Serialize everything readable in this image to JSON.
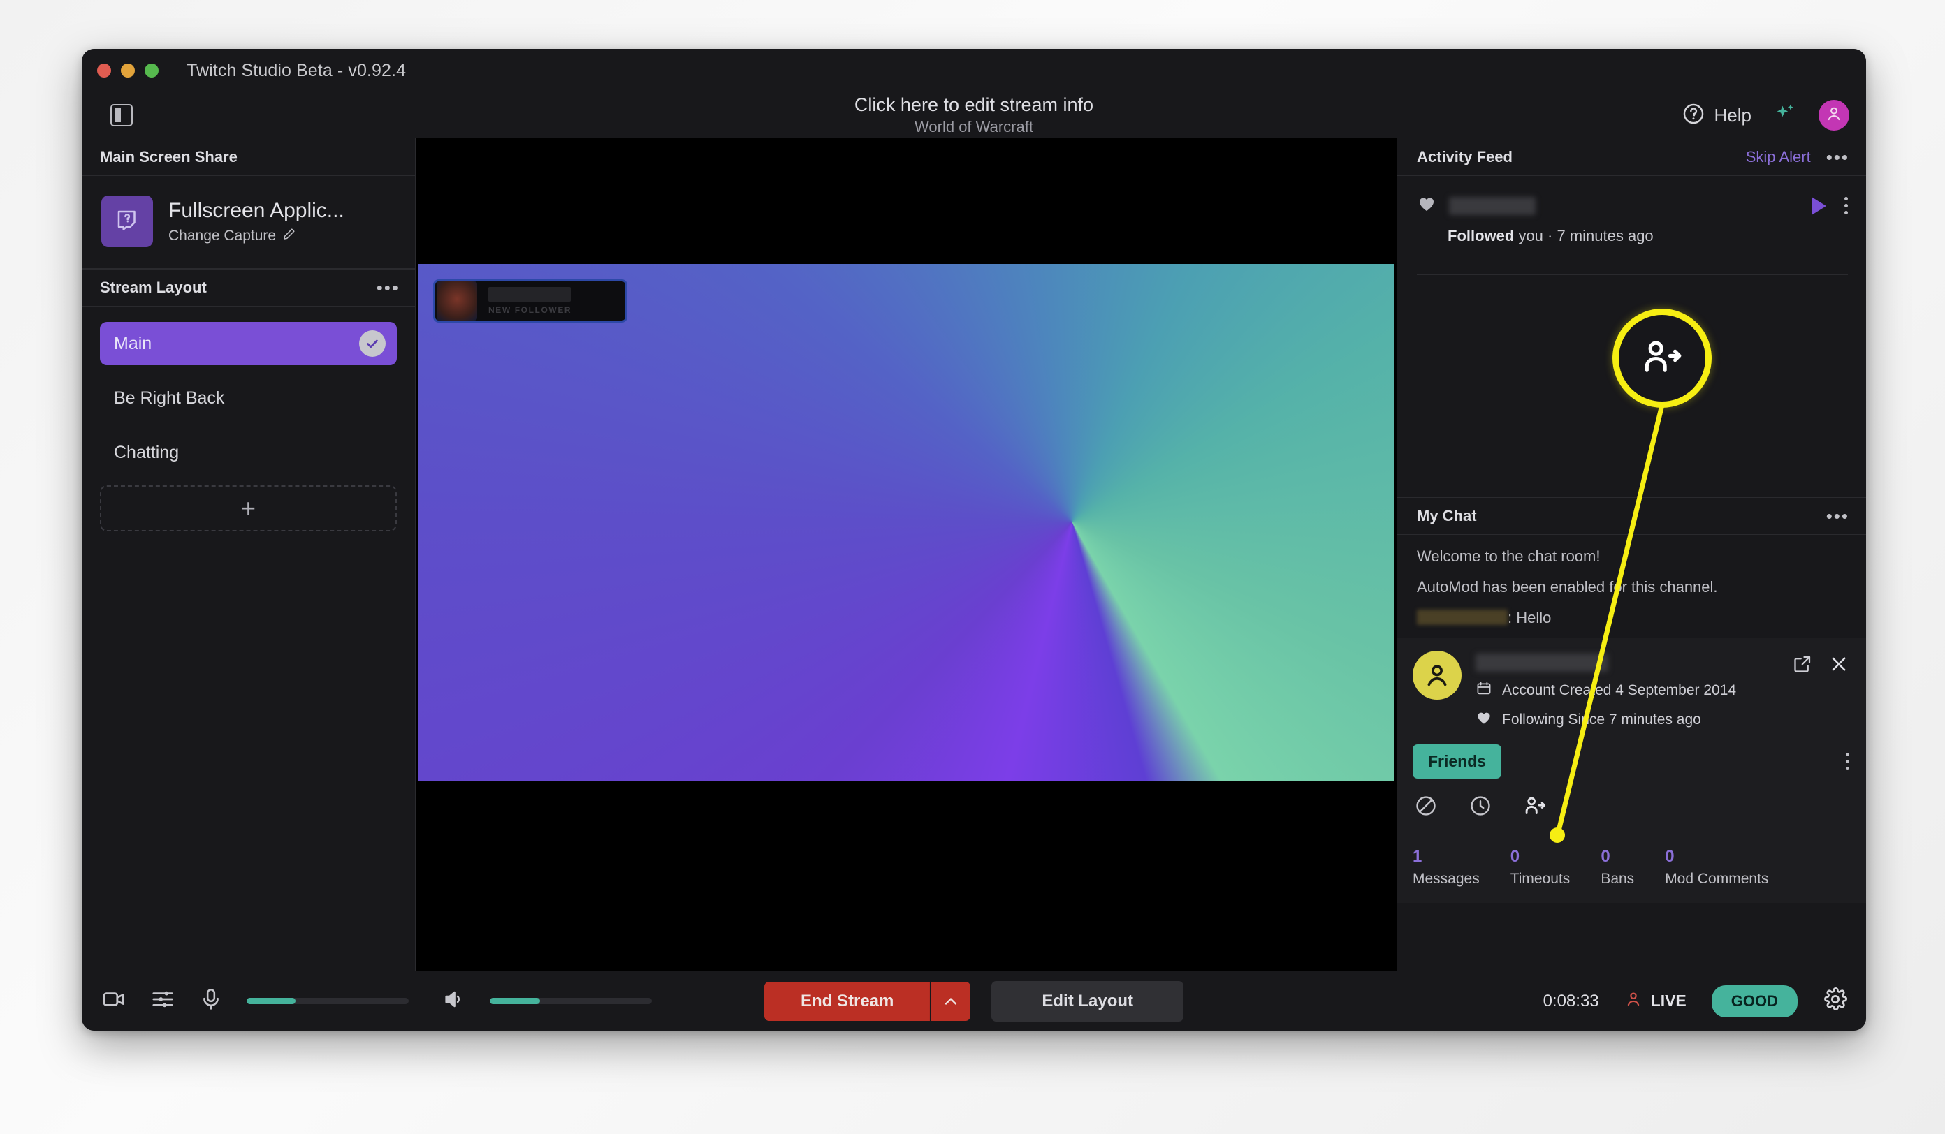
{
  "window": {
    "app_title": "Twitch Studio Beta - v0.92.4"
  },
  "topbar": {
    "stream_info_title": "Click here to edit stream info",
    "stream_info_category": "World of Warcraft",
    "help_label": "Help"
  },
  "sidebar": {
    "screen_share_header": "Main Screen Share",
    "capture_name": "Fullscreen Applic...",
    "capture_change": "Change Capture",
    "stream_layout_header": "Stream Layout",
    "layouts": [
      {
        "label": "Main",
        "active": true
      },
      {
        "label": "Be Right Back",
        "active": false
      },
      {
        "label": "Chatting",
        "active": false
      }
    ],
    "add_layout_label": "+"
  },
  "preview": {
    "alert_subtitle": "NEW FOLLOWER"
  },
  "activity_feed": {
    "header": "Activity Feed",
    "skip_alert": "Skip Alert",
    "more": "•••",
    "item_action": "Followed",
    "item_action_rest": " you · 7 minutes ago"
  },
  "chat": {
    "header": "My Chat",
    "more": "•••",
    "messages": [
      "Welcome to the chat room!",
      "AutoMod has been enabled for this channel."
    ],
    "user_message_suffix": ": Hello"
  },
  "user_card": {
    "account_created": "Account Created 4 September 2014",
    "following_since": "Following Since 7 minutes ago",
    "friends_badge": "Friends",
    "stats": [
      {
        "value": "1",
        "label": "Messages"
      },
      {
        "value": "0",
        "label": "Timeouts"
      },
      {
        "value": "0",
        "label": "Bans"
      },
      {
        "value": "0",
        "label": "Mod Comments"
      }
    ]
  },
  "bottombar": {
    "end_stream_label": "End Stream",
    "edit_layout_label": "Edit Layout",
    "timer": "0:08:33",
    "live_label": "LIVE",
    "health_label": "GOOD",
    "mic_level_pct": 30,
    "desktop_level_pct": 31
  },
  "annotation": {
    "icon": "add-person-icon",
    "color": "#f6ee13"
  },
  "colors": {
    "accent_purple": "#7a4fd6",
    "teal": "#45b39c",
    "red": "#bb2f24",
    "avatar_pink": "#c336b4",
    "highlight_yellow": "#f6ee13"
  }
}
